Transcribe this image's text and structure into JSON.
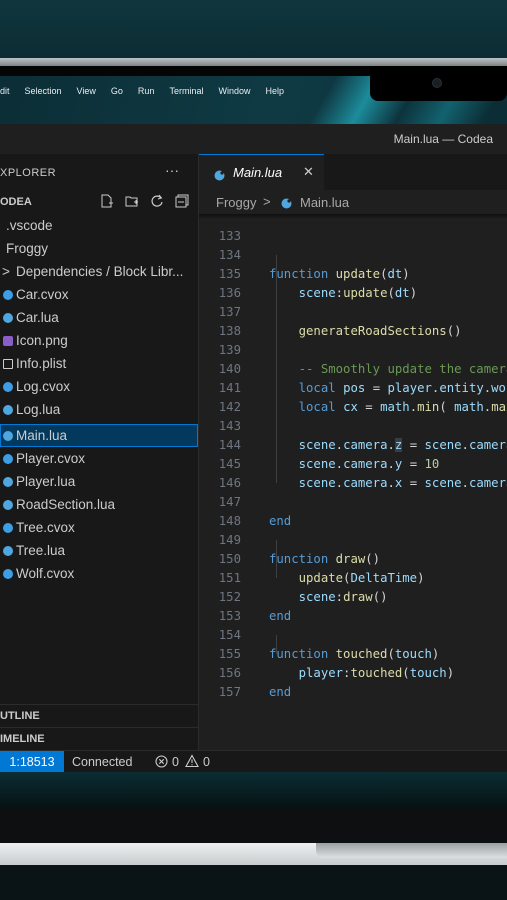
{
  "menubar": {
    "items": [
      "dit",
      "Selection",
      "View",
      "Go",
      "Run",
      "Terminal",
      "Window",
      "Help"
    ]
  },
  "titlebar": {
    "title": "Main.lua — Codea"
  },
  "sidebar": {
    "header": "XPLORER",
    "more": "···",
    "project": "ODEA",
    "items": [
      {
        "label": ".vscode",
        "icon": "none"
      },
      {
        "label": "Froggy",
        "icon": "none"
      },
      {
        "label": "Dependencies / Block Libr...",
        "icon": "chevron-right-icon"
      },
      {
        "label": "Car.cvox",
        "icon": "cvox-icon"
      },
      {
        "label": "Car.lua",
        "icon": "lua-icon"
      },
      {
        "label": "Icon.png",
        "icon": "image-icon"
      },
      {
        "label": "Info.plist",
        "icon": "plist-icon"
      },
      {
        "label": "Log.cvox",
        "icon": "cvox-icon"
      },
      {
        "label": "Log.lua",
        "icon": "lua-icon"
      },
      {
        "label": "Main.lua",
        "icon": "lua-icon",
        "selected": true
      },
      {
        "label": "Player.cvox",
        "icon": "cvox-icon"
      },
      {
        "label": "Player.lua",
        "icon": "lua-icon"
      },
      {
        "label": "RoadSection.lua",
        "icon": "lua-icon"
      },
      {
        "label": "Tree.cvox",
        "icon": "cvox-icon"
      },
      {
        "label": "Tree.lua",
        "icon": "lua-icon"
      },
      {
        "label": "Wolf.cvox",
        "icon": "cvox-icon"
      }
    ],
    "outline": "UTLINE",
    "timeline": "IMELINE"
  },
  "editor": {
    "tab": {
      "label": "Main.lua",
      "close": "✕"
    },
    "breadcrumb": {
      "folder": "Froggy",
      "sep": ">",
      "file": "Main.lua"
    },
    "lines": [
      {
        "n": "133",
        "code": ""
      },
      {
        "n": "134",
        "code": "function update(dt)"
      },
      {
        "n": "135",
        "code": "    scene:update(dt)"
      },
      {
        "n": "136",
        "code": ""
      },
      {
        "n": "137",
        "code": "    generateRoadSections()"
      },
      {
        "n": "138",
        "code": ""
      },
      {
        "n": "139",
        "code": "    -- Smoothly update the camera"
      },
      {
        "n": "140",
        "code": "    local pos = player.entity.worldPosition"
      },
      {
        "n": "141",
        "code": "    local cx = math.min( math.max("
      },
      {
        "n": "142",
        "code": ""
      },
      {
        "n": "143",
        "code": "    scene.camera.z = scene.camera.z"
      },
      {
        "n": "144",
        "code": "    scene.camera.y = 10"
      },
      {
        "n": "145",
        "code": "    scene.camera.x = scene.camera.x"
      },
      {
        "n": "146",
        "code": ""
      },
      {
        "n": "147",
        "code": "end"
      },
      {
        "n": "148",
        "code": ""
      },
      {
        "n": "149",
        "code": "function draw()"
      },
      {
        "n": "150",
        "code": "    update(DeltaTime)"
      },
      {
        "n": "151",
        "code": "    scene:draw()"
      },
      {
        "n": "152",
        "code": "end"
      },
      {
        "n": "153",
        "code": ""
      },
      {
        "n": "154",
        "code": "function touched(touch)"
      },
      {
        "n": "155",
        "code": "    player:touched(touch)"
      },
      {
        "n": "156",
        "code": "end"
      },
      {
        "n": "157",
        "code": ""
      }
    ]
  },
  "statusbar": {
    "position": "1:18513",
    "connection": "Connected",
    "errors": "0",
    "warnings": "0"
  },
  "colors": {
    "accent": "#0078d4",
    "keyword": "#569cd6",
    "function": "#dcdcaa",
    "variable": "#9cdcfe",
    "comment": "#6a9955",
    "number": "#b5cea8"
  }
}
